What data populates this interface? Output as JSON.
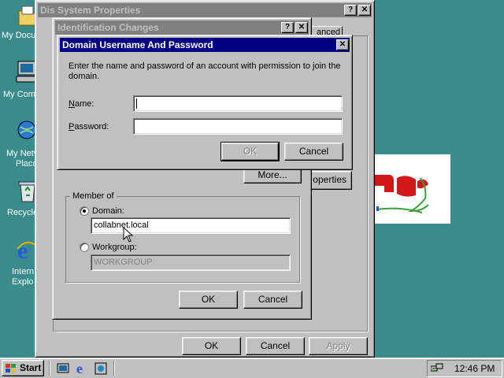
{
  "desktop": {
    "icons": [
      {
        "label": "My Docu"
      },
      {
        "label": "My Comp"
      },
      {
        "label": "My Netw",
        "label2": "Place"
      },
      {
        "label": "Recycle"
      },
      {
        "label": "Intern",
        "label2": "Explo"
      }
    ]
  },
  "system_properties": {
    "title": "Dis  System Properties",
    "help": "?",
    "close": "✕",
    "tab_fragment": "anced",
    "properties_fragment": "operties",
    "ok": "OK",
    "cancel": "Cancel",
    "apply": "Apply"
  },
  "identification_changes": {
    "title": "Identification Changes",
    "help": "?",
    "close": "✕",
    "more_button": "More...",
    "member_of": "Member of",
    "domain_label": "Domain:",
    "domain_value": "collabnet.local",
    "workgroup_label": "Workgroup:",
    "workgroup_value": "WORKGROUP",
    "ok": "OK",
    "cancel": "Cancel"
  },
  "domain_dialog": {
    "title": "Domain Username And Password",
    "close": "✕",
    "instructions": "Enter the name and password of an account with permission to join the domain.",
    "name_label": "Name:",
    "name_value": "",
    "password_label": "Password:",
    "password_value": "",
    "ok": "OK",
    "cancel": "Cancel"
  },
  "taskbar": {
    "start": "Start",
    "clock": "12:46 PM"
  },
  "colors": {
    "desktop": "#3a8c8c",
    "active_title": "#000080",
    "inactive_title": "#808080",
    "face": "#c0c0c0"
  }
}
